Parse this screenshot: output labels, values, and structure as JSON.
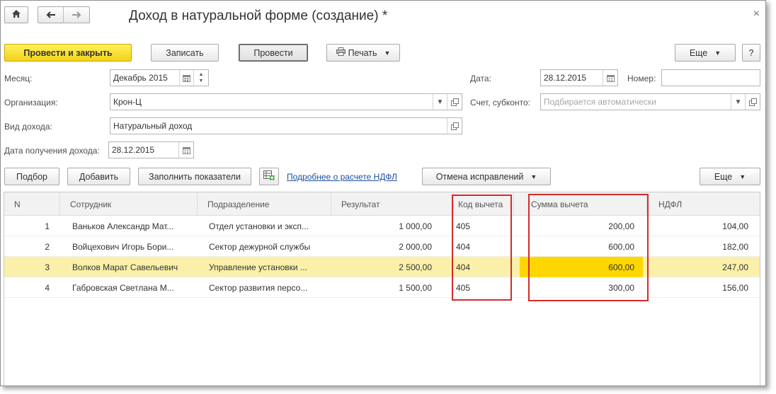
{
  "window": {
    "title": "Доход в натуральной форме (создание) *",
    "close_glyph": "×"
  },
  "toolbar": {
    "post_close": "Провести и закрыть",
    "save": "Записать",
    "post": "Провести",
    "print": "Печать",
    "more": "Еще",
    "help": "?"
  },
  "form": {
    "month_label": "Месяц:",
    "month_value": "Декабрь 2015",
    "date_label": "Дата:",
    "date_value": "28.12.2015",
    "number_label": "Номер:",
    "number_value": "",
    "org_label": "Организация:",
    "org_value": "Крон-Ц",
    "account_label": "Счет, субконто:",
    "account_placeholder": "Подбирается автоматически",
    "income_type_label": "Вид дохода:",
    "income_type_value": "Натуральный доход",
    "receive_date_label": "Дата получения дохода:",
    "receive_date_value": "28.12.2015"
  },
  "table_toolbar": {
    "pick": "Подбор",
    "add": "Добавить",
    "fill": "Заполнить показатели",
    "ndfl_link": "Подробнее о расчете НДФЛ",
    "cancel_corrections": "Отмена исправлений",
    "more": "Еще"
  },
  "table": {
    "columns": [
      "N",
      "Сотрудник",
      "Подразделение",
      "Результат",
      "Код вычета",
      "Сумма вычета",
      "НДФЛ"
    ],
    "rows": [
      {
        "n": "1",
        "employee": "Ваньков Александр Мат...",
        "dept": "Отдел установки и эксп...",
        "result": "1 000,00",
        "code": "405",
        "deduction": "200,00",
        "ndfl": "104,00"
      },
      {
        "n": "2",
        "employee": "Войцехович Игорь Бори...",
        "dept": "Сектор дежурной службы",
        "result": "2 000,00",
        "code": "404",
        "deduction": "600,00",
        "ndfl": "182,00"
      },
      {
        "n": "3",
        "employee": "Волков Марат Савельевич",
        "dept": "Управление установки ...",
        "result": "2 500,00",
        "code": "404",
        "deduction": "600,00",
        "ndfl": "247,00"
      },
      {
        "n": "4",
        "employee": "Габровская Светлана М...",
        "dept": "Сектор развития персо...",
        "result": "1 500,00",
        "code": "405",
        "deduction": "300,00",
        "ndfl": "156,00"
      }
    ]
  },
  "colors": {
    "primary_button": "#f3d21a",
    "selected_row": "#fbf0a9",
    "highlight_cell": "#ffd700",
    "annotation_box": "#d52b2b",
    "link": "#1a4fa0"
  }
}
